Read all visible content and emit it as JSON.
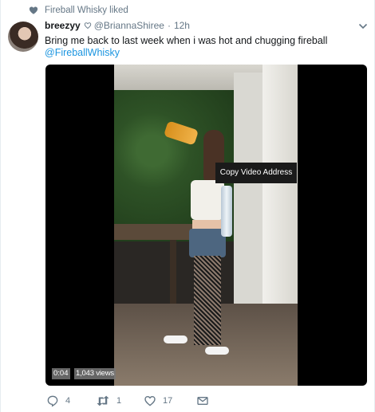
{
  "social_context": {
    "text": "Fireball Whisky liked",
    "icon": "heart-icon"
  },
  "tweet": {
    "display_name": "breezyy",
    "name_badge_icon": "heart-outline-icon",
    "screen_name": "@BriannaShiree",
    "separator": "·",
    "timestamp": "12h",
    "text": "Bring me back to last week when i was hot and chugging fireball",
    "mention": "@FireballWhisky",
    "menu_icon": "chevron-down-icon"
  },
  "media": {
    "context_menu_item": "Copy Video Address",
    "elapsed_time": "0:04",
    "view_count": "1,043 views"
  },
  "actions": {
    "reply_count": "4",
    "retweet_count": "1",
    "like_count": "17"
  },
  "colors": {
    "link": "#1b95e0",
    "secondary_text": "#657786",
    "primary_text": "#14171a"
  }
}
